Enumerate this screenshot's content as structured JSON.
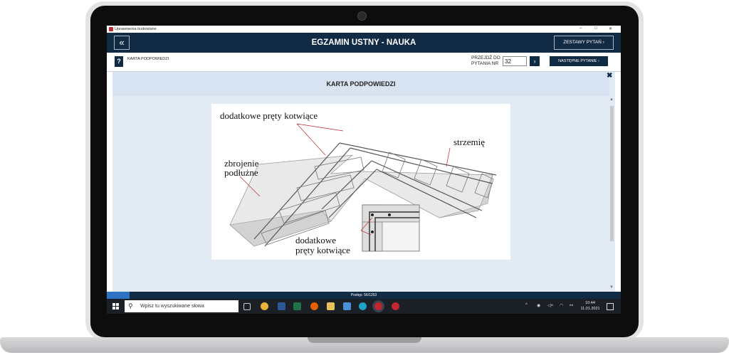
{
  "window": {
    "title": "Uprawnienia budowlane",
    "minimize": "–",
    "maximize": "□",
    "close": "✕"
  },
  "header": {
    "back_label": "«",
    "title": "EGZAMIN USTNY - NAUKA",
    "sets_button": "ZESTAWY PYTAŃ  ›"
  },
  "subbar": {
    "hint_icon": "?",
    "hint_label": "KARTA PODPOWIEDZI",
    "goto_label": "PRZEJDŹ DO PYTANIA NR",
    "goto_value": "32",
    "goto_button": "›",
    "next_button": "NASTĘPNE PYTANIE  ›"
  },
  "panel": {
    "title": "KARTA PODPOWIEDZI",
    "close_label": "✖",
    "figure_labels": {
      "top": "dodatkowe pręty kotwiące",
      "right": "strzemię",
      "left_line1": "zbrojenie",
      "left_line2": "podłużne",
      "bottom_line1": "dodatkowe",
      "bottom_line2": "pręty kotwiące"
    }
  },
  "status": {
    "text": "Postęp: 56/1253",
    "progress": 0.045
  },
  "taskbar": {
    "search_placeholder": "Wpisz tu wyszukiwane słowa",
    "time": "10:44",
    "date": "11.01.2021"
  },
  "colors": {
    "navy": "#112b45",
    "panel": "#e2eaf4",
    "accent": "#2e72c4"
  }
}
